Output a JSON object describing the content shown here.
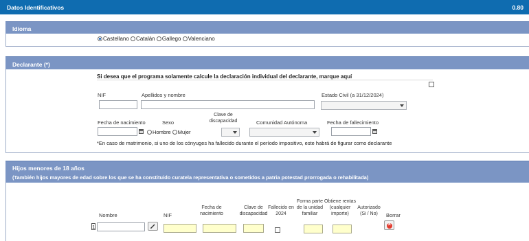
{
  "header": {
    "title": "Datos Identificativos",
    "value": "0.80"
  },
  "idioma": {
    "title": "Idioma",
    "options": [
      "Castellano",
      "Catalán",
      "Gallego",
      "Valenciano"
    ],
    "selected": "Castellano"
  },
  "declarante": {
    "title": "Declarante (*)",
    "individual_text": "Si desea que el programa solamente calcule la declaración individual del declarante, marque aquí",
    "nif_label": "NIF",
    "nombre_label": "Apellidos y nombre",
    "estado_civil_label": "Estado Civil (a 31/12/2024)",
    "fecha_nac_label": "Fecha de nacimiento",
    "sexo_label": "Sexo",
    "sexo_options": [
      "Hombre",
      "Mujer"
    ],
    "discapacidad_label": "Clave de discapacidad",
    "comunidad_label": "Comunidad Autónoma",
    "fallecimiento_label": "Fecha de fallecimiento",
    "nota": "*En caso de matrimonio, si uno de los cónyuges ha fallecido durante el período impositivo, este habrá de figurar como declarante"
  },
  "hijos": {
    "title": "Hijos menores de 18 años",
    "subtitle": "(También hijos mayores de edad sobre los que se ha constituido curatela representativa o sometidos a patria potestad prorrogada o rehabilitada)",
    "columns": {
      "nombre": "Nombre",
      "nif": "NIF",
      "fecha_nac": "Fecha de nacimiento",
      "discapacidad": "Clave de discapacidad",
      "fallecido": "Fallecido en 2024",
      "forma_parte": "Forma parte de la unidad familiar",
      "rentas": "Obtiene rentas (cualquier importe)",
      "autorizado": "Autorizado (Si / No)",
      "borrar": "Borrar"
    },
    "row_index": "1"
  }
}
